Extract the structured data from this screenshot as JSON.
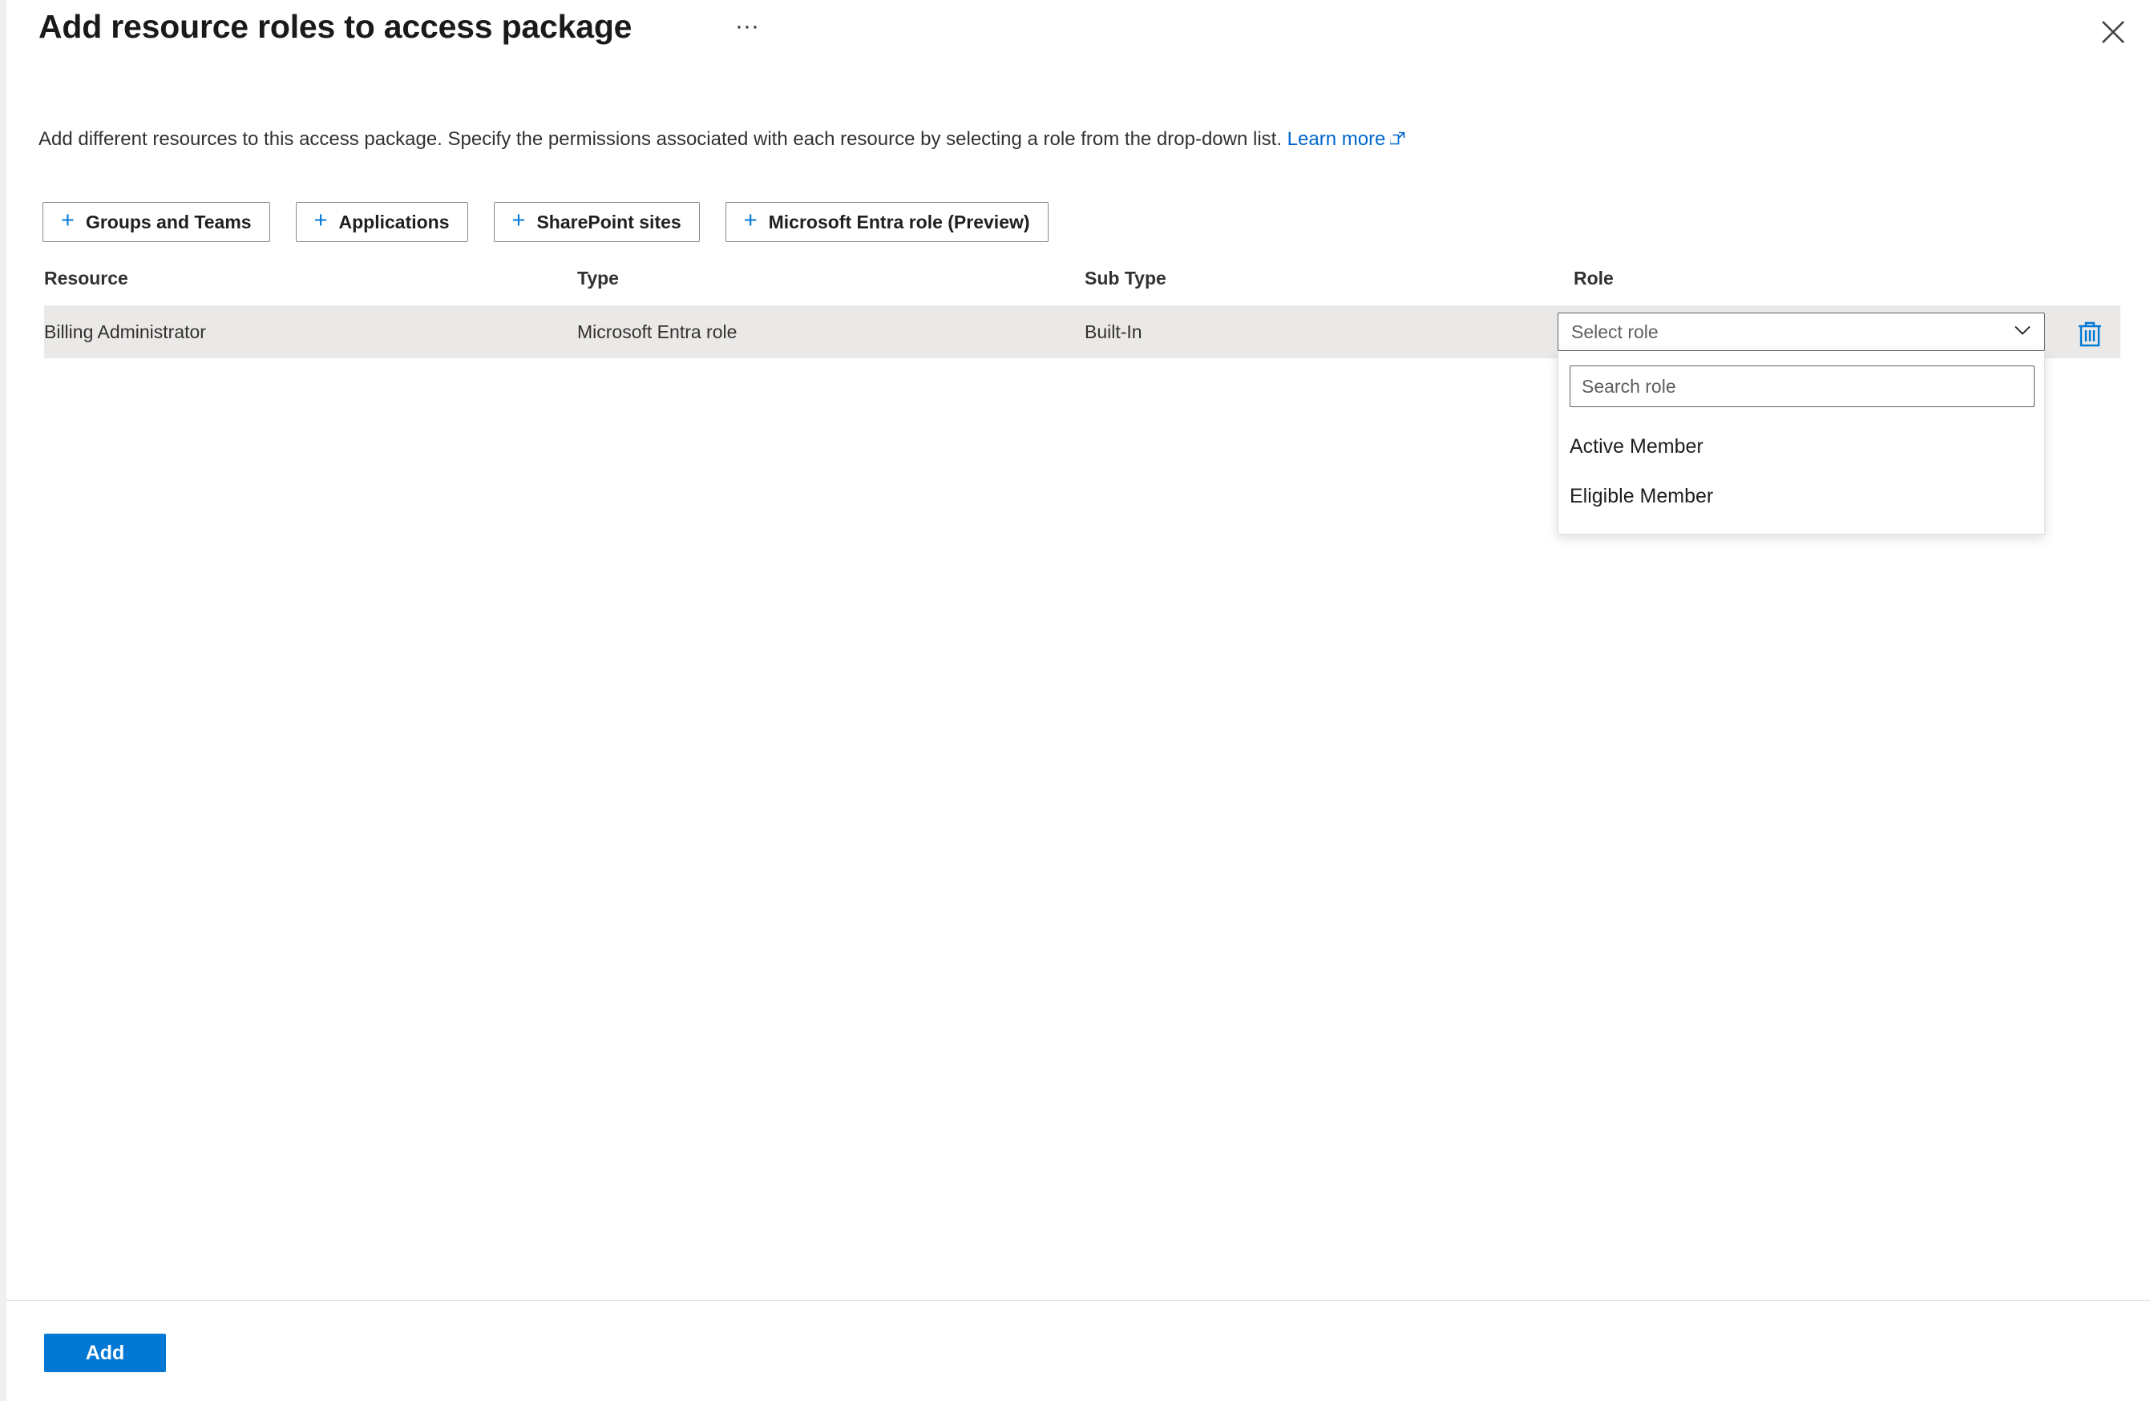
{
  "blade": {
    "title": "Add resource roles to access package",
    "more_label": "···",
    "close_label": "Close",
    "description_text": "Add different resources to this access package. Specify the permissions associated with each resource by selecting a role from the drop-down list.",
    "learn_more_label": "Learn more"
  },
  "commands": [
    {
      "label": "Groups and Teams",
      "icon": "plus-icon"
    },
    {
      "label": "Applications",
      "icon": "plus-icon"
    },
    {
      "label": "SharePoint sites",
      "icon": "plus-icon"
    },
    {
      "label": "Microsoft Entra role (Preview)",
      "icon": "plus-icon"
    }
  ],
  "table": {
    "columns": [
      "Resource",
      "Type",
      "Sub Type",
      "Role"
    ],
    "rows": [
      {
        "resource": "Billing Administrator",
        "type": "Microsoft Entra role",
        "sub_type": "Built-In",
        "role_selected": "Select role",
        "delete_label": "Delete"
      }
    ]
  },
  "role_dropdown": {
    "open": true,
    "placeholder": "Select role",
    "search_placeholder": "Search role",
    "search_value": "",
    "options": [
      "Active Member",
      "Eligible Member"
    ]
  },
  "footer": {
    "add_label": "Add"
  },
  "colors": {
    "accent": "#0078d4",
    "link": "#0066cc",
    "row_highlight": "#ebe9e7",
    "text_primary": "#323130",
    "border": "#8a8886"
  }
}
